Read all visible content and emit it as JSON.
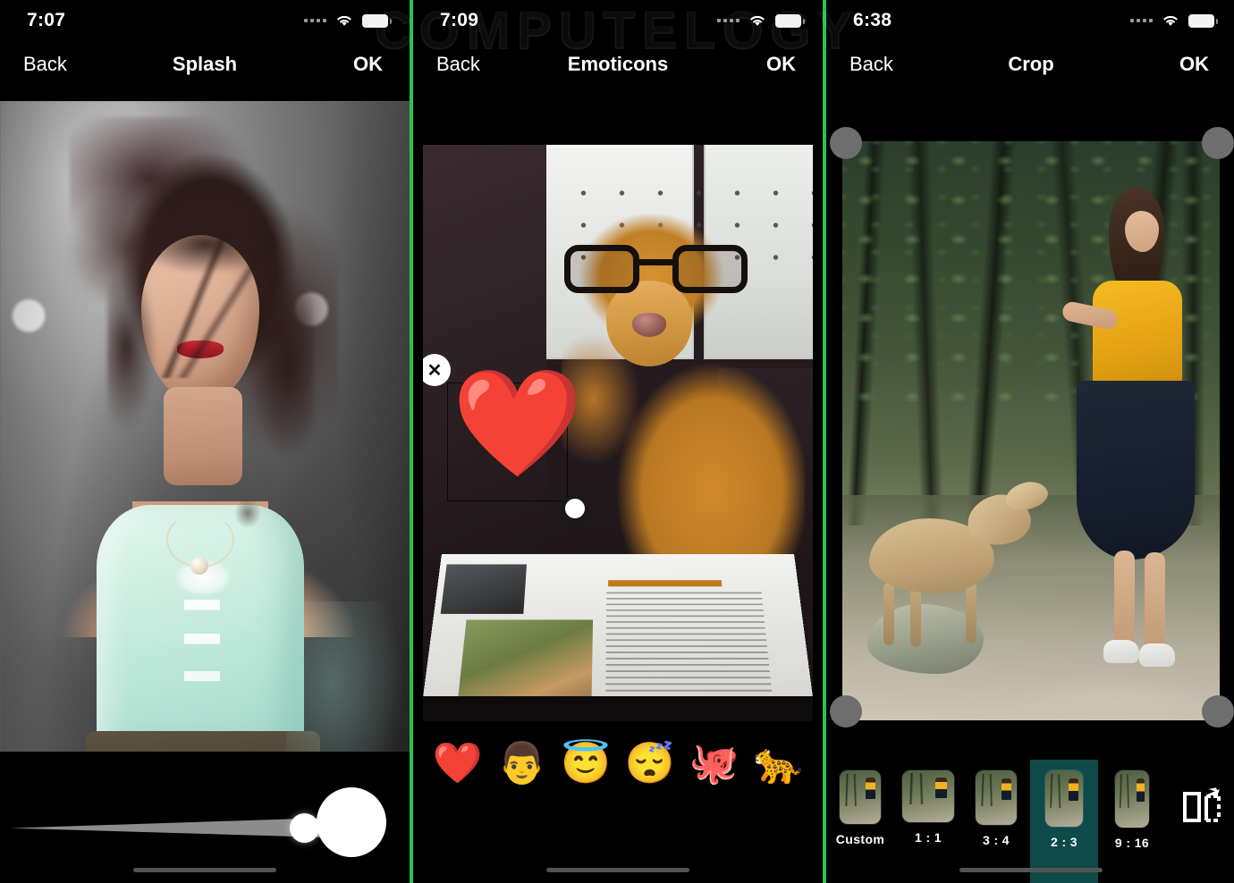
{
  "watermark": "COMPUTELOGY",
  "panels": [
    {
      "id": "splash",
      "status": {
        "time": "7:07",
        "signal_icon": "signal-dots-icon",
        "wifi_icon": "wifi-icon",
        "battery_icon": "battery-icon"
      },
      "nav": {
        "back": "Back",
        "title": "Splash",
        "ok": "OK"
      },
      "controls": {
        "slider_name": "brush-size-slider",
        "slider_value": 88,
        "preview_name": "brush-size-preview"
      }
    },
    {
      "id": "emoticons",
      "status": {
        "time": "7:09",
        "signal_icon": "signal-dots-icon",
        "wifi_icon": "wifi-icon",
        "battery_icon": "battery-icon"
      },
      "nav": {
        "back": "Back",
        "title": "Emoticons",
        "ok": "OK"
      },
      "sticker": {
        "glyph": "❤️",
        "name": "heart-sticker",
        "close_glyph": "✕",
        "close_name": "sticker-close-icon",
        "resize_name": "sticker-resize-handle"
      },
      "emoji_picker": [
        {
          "glyph": "❤️",
          "name": "emoji-red-heart"
        },
        {
          "glyph": "👨",
          "name": "emoji-man"
        },
        {
          "glyph": "😇",
          "name": "emoji-smiling-face-with-halo"
        },
        {
          "glyph": "😴",
          "name": "emoji-sleeping-face"
        },
        {
          "glyph": "🐙",
          "name": "emoji-octopus"
        },
        {
          "glyph": "🐆",
          "name": "emoji-leopard"
        }
      ]
    },
    {
      "id": "crop",
      "status": {
        "time": "6:38",
        "signal_icon": "signal-dots-icon",
        "wifi_icon": "wifi-icon",
        "battery_icon": "battery-icon"
      },
      "nav": {
        "back": "Back",
        "title": "Crop",
        "ok": "OK"
      },
      "ratios": [
        {
          "label": "Custom",
          "selected": false,
          "thumb_w": 46,
          "thumb_h": 60
        },
        {
          "label": "1 : 1",
          "selected": false,
          "thumb_w": 58,
          "thumb_h": 58
        },
        {
          "label": "3 : 4",
          "selected": false,
          "thumb_w": 46,
          "thumb_h": 61
        },
        {
          "label": "2 : 3",
          "selected": true,
          "thumb_w": 42,
          "thumb_h": 63
        },
        {
          "label": "9 : 16",
          "selected": false,
          "thumb_w": 38,
          "thumb_h": 64
        }
      ],
      "flip_button": {
        "name": "flip-rotate-icon"
      }
    }
  ],
  "colors": {
    "divider_green": "#2bc24f",
    "selected_teal": "#0e4a4a",
    "background": "#000000",
    "text": "#ffffff"
  }
}
